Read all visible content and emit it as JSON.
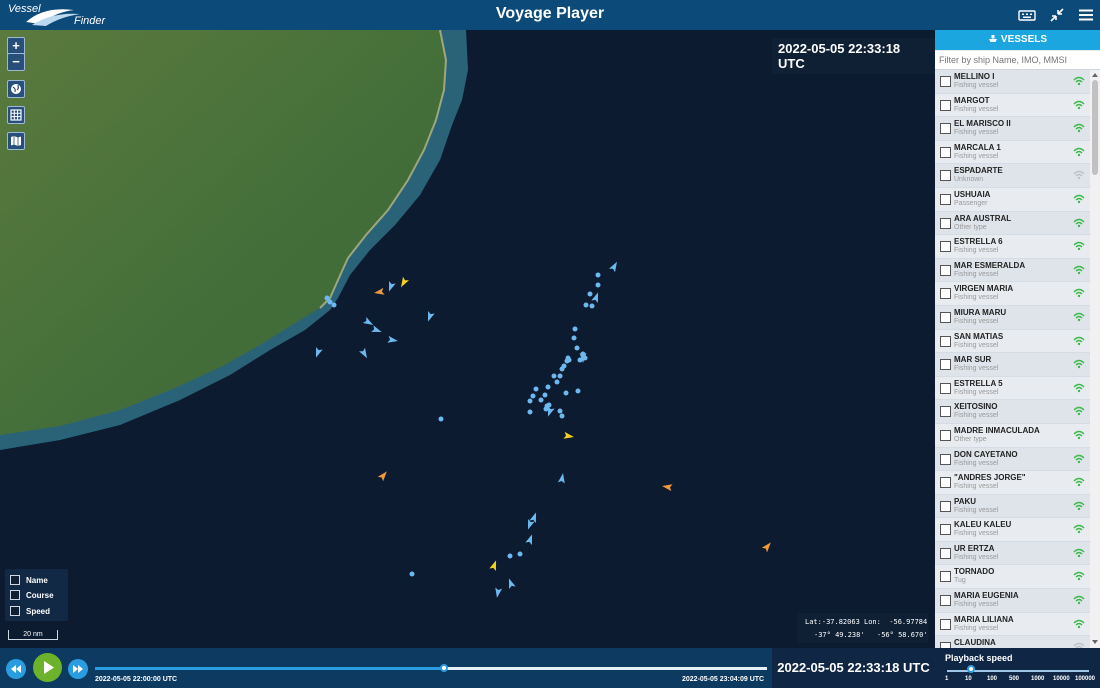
{
  "header": {
    "logo_top": "Vessel",
    "logo_bottom": "Finder",
    "title": "Voyage Player",
    "icons": [
      "keyboard-icon",
      "collapse-icon",
      "menu-icon"
    ]
  },
  "map": {
    "timestamp": "2022-05-05 22:33:18 UTC",
    "controls": [
      "zoom-in",
      "zoom-out",
      "globe",
      "grid",
      "map-layers"
    ],
    "legend": {
      "name_label": "Name",
      "course_label": "Course",
      "speed_label": "Speed"
    },
    "scale_label": "20 nm",
    "coords": {
      "lat_dec": "Lat:-37.82063",
      "lon_dec": "Lon:  -56.97784",
      "lat_dms": "-37° 49.238'",
      "lon_dms": "-56° 58.670'"
    },
    "colors": {
      "sea": "#0d1b30",
      "land": "#3f6a34",
      "vessel_blue": "#6cb8ef",
      "vessel_yellow": "#f2d21e",
      "vessel_orange": "#ee9a3a"
    }
  },
  "sidebar": {
    "header": "VESSELS",
    "filter_placeholder": "Filter by ship Name, IMO, MMSI",
    "vessels": [
      {
        "name": "MELLINO I",
        "type": "Fishing vessel"
      },
      {
        "name": "MARGOT",
        "type": "Fishing vessel"
      },
      {
        "name": "EL MARISCO II",
        "type": "Fishing vessel"
      },
      {
        "name": "MARCALA 1",
        "type": "Fishing vessel"
      },
      {
        "name": "ESPADARTE",
        "type": "Unknown"
      },
      {
        "name": "USHUAIA",
        "type": "Passenger"
      },
      {
        "name": "ARA AUSTRAL",
        "type": "Other type"
      },
      {
        "name": "ESTRELLA 6",
        "type": "Fishing vessel"
      },
      {
        "name": "MAR ESMERALDA",
        "type": "Fishing vessel"
      },
      {
        "name": "VIRGEN MARIA",
        "type": "Fishing vessel"
      },
      {
        "name": "MIURA MARU",
        "type": "Fishing vessel"
      },
      {
        "name": "SAN MATIAS",
        "type": "Fishing vessel"
      },
      {
        "name": "MAR SUR",
        "type": "Fishing vessel"
      },
      {
        "name": "ESTRELLA 5",
        "type": "Fishing vessel"
      },
      {
        "name": "XEITOSINO",
        "type": "Fishing vessel"
      },
      {
        "name": "MADRE INMACULADA",
        "type": "Other type"
      },
      {
        "name": "DON CAYETANO",
        "type": "Fishing vessel"
      },
      {
        "name": "\"ANDRES JORGE\"",
        "type": "Fishing vessel"
      },
      {
        "name": "PAKU",
        "type": "Fishing vessel"
      },
      {
        "name": "KALEU KALEU",
        "type": "Fishing vessel"
      },
      {
        "name": "UR ERTZA",
        "type": "Fishing vessel"
      },
      {
        "name": "TORNADO",
        "type": "Tug"
      },
      {
        "name": "MARIA EUGENIA",
        "type": "Fishing vessel"
      },
      {
        "name": "MARIA LILIANA",
        "type": "Fishing vessel"
      },
      {
        "name": "CLAUDINA",
        "type": ""
      }
    ]
  },
  "player": {
    "start_time": "2022-05-05 22:00:00 UTC",
    "end_time": "2022-05-05 23:04:09 UTC",
    "current_time": "2022-05-05 22:33:18 UTC",
    "progress": 0.52,
    "speed_label": "Playback speed",
    "speed_options": [
      "1",
      "10",
      "100",
      "500",
      "1000",
      "10000",
      "100000"
    ],
    "speed_selected": "10"
  }
}
